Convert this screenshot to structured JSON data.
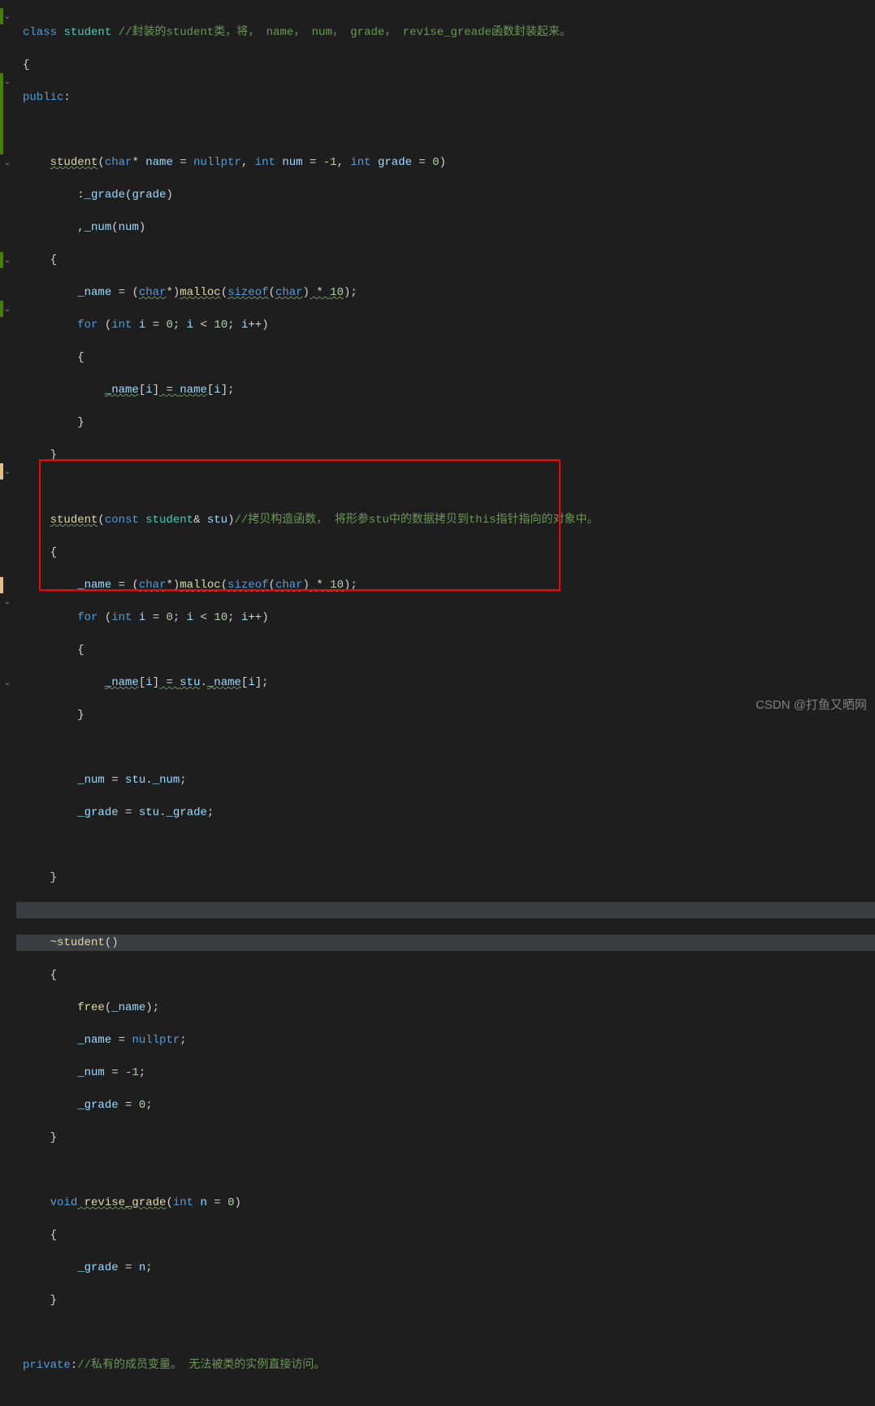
{
  "code": {
    "l1_kw1": "class",
    "l1_cls": "student",
    "l1_cmt": " //封装的student类，将， name， num， grade， revise_greade函数封装起来。",
    "l2": "{",
    "l3_kw": "public",
    "l3_colon": ":",
    "l5_fn": "student",
    "l5_p1": "(",
    "l5_t1": "char",
    "l5_star": "*",
    "l5_v1": " name ",
    "l5_eq1": "=",
    "l5_kw1": " nullptr",
    "l5_c1": ", ",
    "l5_t2": "int",
    "l5_v2": " num ",
    "l5_eq2": "=",
    "l5_n1": " -1",
    "l5_c2": ", ",
    "l5_t3": "int",
    "l5_v3": " grade ",
    "l5_eq3": "=",
    "l5_n2": " 0",
    "l5_p2": ")",
    "l6_colon": ":",
    "l6_v1": "_grade",
    "l6_p1": "(",
    "l6_v2": "grade",
    "l6_p2": ")",
    "l7_c": ",",
    "l7_v1": "_num",
    "l7_p1": "(",
    "l7_v2": "num",
    "l7_p2": ")",
    "l8": "{",
    "l9_v1": "_name",
    "l9_eq": " = ",
    "l9_p1": "(",
    "l9_t1": "char",
    "l9_star": "*",
    "l9_p2": ")",
    "l9_fn": "malloc",
    "l9_p3": "(",
    "l9_kw": "sizeof",
    "l9_p4": "(",
    "l9_t2": "char",
    "l9_p5": ")",
    "l9_op": " * ",
    "l9_n": "10",
    "l9_p6": ")",
    "l9_sc": ";",
    "l10_kw": "for",
    "l10_p1": " (",
    "l10_t": "int",
    "l10_v": " i ",
    "l10_eq": "=",
    "l10_n1": " 0",
    "l10_sc1": "; ",
    "l10_v2": "i ",
    "l10_op": "<",
    "l10_n2": " 10",
    "l10_sc2": "; ",
    "l10_v3": "i",
    "l10_op2": "++",
    "l10_p2": ")",
    "l11": "{",
    "l12_v1": "_name",
    "l12_b1": "[",
    "l12_v2": "i",
    "l12_b2": "]",
    "l12_eq": " = ",
    "l12_v3": "name",
    "l12_b3": "[",
    "l12_v4": "i",
    "l12_b4": "]",
    "l12_sc": ";",
    "l13": "}",
    "l14": "}",
    "l16_fn": "student",
    "l16_p1": "(",
    "l16_kw": "const",
    "l16_cls": " student",
    "l16_amp": "&",
    "l16_v": " stu",
    "l16_p2": ")",
    "l16_cmt": "//拷贝构造函数， 将形参stu中的数据拷贝到this指针指向的对象中。",
    "l17": "{",
    "l18_v1": "_name",
    "l18_eq": " = ",
    "l18_p1": "(",
    "l18_t1": "char",
    "l18_star": "*",
    "l18_p2": ")",
    "l18_fn": "malloc",
    "l18_p3": "(",
    "l18_kw": "sizeof",
    "l18_p4": "(",
    "l18_t2": "char",
    "l18_p5": ")",
    "l18_op": " * ",
    "l18_n": "10",
    "l18_p6": ")",
    "l18_sc": ";",
    "l19_kw": "for",
    "l19_p1": " (",
    "l19_t": "int",
    "l19_v": " i ",
    "l19_eq": "=",
    "l19_n1": " 0",
    "l19_sc1": "; ",
    "l19_v2": "i ",
    "l19_op": "<",
    "l19_n2": " 10",
    "l19_sc2": "; ",
    "l19_v3": "i",
    "l19_op2": "++",
    "l19_p2": ")",
    "l20": "{",
    "l21_v1": "_name",
    "l21_b1": "[",
    "l21_v2": "i",
    "l21_b2": "]",
    "l21_eq": " = ",
    "l21_v3": "stu",
    "l21_dot": ".",
    "l21_v4": "_name",
    "l21_b3": "[",
    "l21_v5": "i",
    "l21_b4": "]",
    "l21_sc": ";",
    "l22": "}",
    "l24_v1": "_num",
    "l24_eq": " = ",
    "l24_v2": "stu",
    "l24_dot": ".",
    "l24_v3": "_num",
    "l24_sc": ";",
    "l25_v1": "_grade",
    "l25_eq": " = ",
    "l25_v2": "stu",
    "l25_dot": ".",
    "l25_v3": "_grade",
    "l25_sc": ";",
    "l27": "}",
    "l29_tilde": "~",
    "l29_fn": "student",
    "l29_p": "()",
    "l30": "{",
    "l31_fn": "free",
    "l31_p1": "(",
    "l31_v": "_name",
    "l31_p2": ")",
    "l31_sc": ";",
    "l32_v": "_name",
    "l32_eq": " = ",
    "l32_kw": "nullptr",
    "l32_sc": ";",
    "l33_v": "_num",
    "l33_eq": " = ",
    "l33_n": "-1",
    "l33_sc": ";",
    "l34_v": "_grade",
    "l34_eq": " = ",
    "l34_n": "0",
    "l34_sc": ";",
    "l35": "}",
    "l37_kw": "void",
    "l37_fn": " revise_grade",
    "l37_p1": "(",
    "l37_t": "int",
    "l37_v": " n ",
    "l37_eq": "=",
    "l37_n": " 0",
    "l37_p2": ")",
    "l38": "{",
    "l39_v": "_grade",
    "l39_eq": " = ",
    "l39_v2": "n",
    "l39_sc": ";",
    "l40": "}",
    "l42_kw": "private",
    "l42_colon": ":",
    "l42_cmt": "//私有的成员变量。 无法被类的实例直接访问。"
  },
  "watermark": "CSDN @打鱼又晒网"
}
